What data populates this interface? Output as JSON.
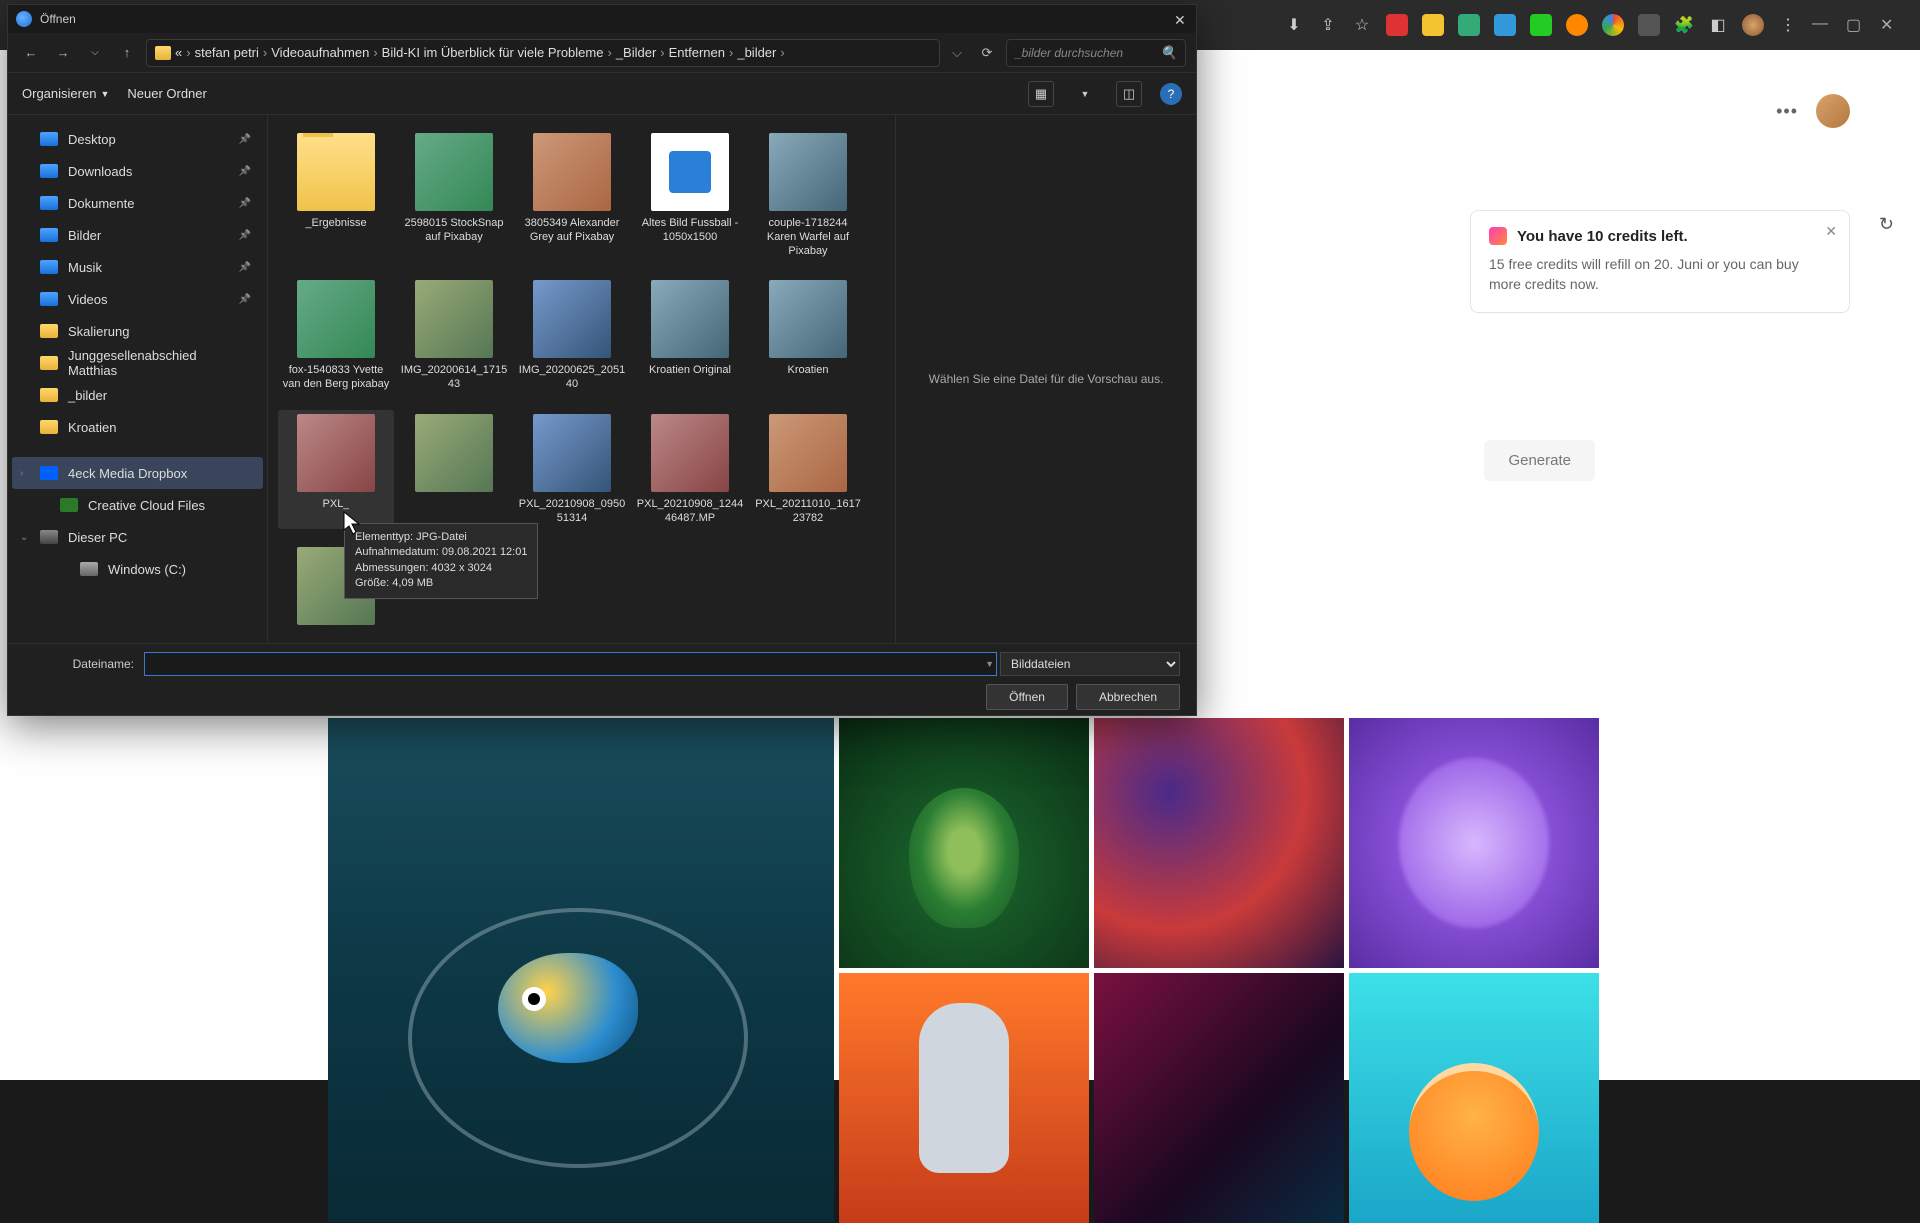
{
  "dialog": {
    "title": "Öffnen",
    "breadcrumb": [
      "«",
      "stefan petri",
      "Videoaufnahmen",
      "Bild-KI im Überblick für viele Probleme",
      "_Bilder",
      "Entfernen",
      "_bilder"
    ],
    "search_placeholder": "_bilder durchsuchen",
    "organize_label": "Organisieren",
    "new_folder_label": "Neuer Ordner",
    "preview_hint": "Wählen Sie eine Datei für die Vorschau aus.",
    "filename_label": "Dateiname:",
    "filetype_label": "Bilddateien",
    "open_btn": "Öffnen",
    "cancel_btn": "Abbrechen",
    "tooltip": {
      "l1": "Elementtyp: JPG-Datei",
      "l2": "Aufnahmedatum: 09.08.2021 12:01",
      "l3": "Abmessungen: 4032 x 3024",
      "l4": "Größe: 4,09 MB"
    },
    "sidebar": [
      {
        "icon": "desktop",
        "label": "Desktop",
        "pin": true
      },
      {
        "icon": "dl",
        "label": "Downloads",
        "pin": true
      },
      {
        "icon": "doc",
        "label": "Dokumente",
        "pin": true
      },
      {
        "icon": "pic",
        "label": "Bilder",
        "pin": true
      },
      {
        "icon": "mus",
        "label": "Musik",
        "pin": true
      },
      {
        "icon": "vid",
        "label": "Videos",
        "pin": true
      },
      {
        "icon": "folder",
        "label": "Skalierung"
      },
      {
        "icon": "folder",
        "label": "Junggesellenabschied Matthias"
      },
      {
        "icon": "folder",
        "label": "_bilder"
      },
      {
        "icon": "folder",
        "label": "Kroatien"
      }
    ],
    "sidebar2": [
      {
        "icon": "dropbox",
        "label": "4eck Media Dropbox",
        "exp": "›",
        "active": true
      },
      {
        "icon": "cc",
        "label": "Creative Cloud Files",
        "lvl": 2
      },
      {
        "icon": "pc",
        "label": "Dieser PC",
        "exp": "⌄",
        "lvl": 1
      },
      {
        "icon": "drive",
        "label": "Windows (C:)",
        "lvl": 3
      }
    ],
    "files": [
      {
        "name": "_Ergebnisse",
        "thumb": "folder-t"
      },
      {
        "name": "2598015 StockSnap auf Pixabay",
        "thumb": "ph"
      },
      {
        "name": "3805349 Alexander Grey auf Pixabay",
        "thumb": "ph2"
      },
      {
        "name": "Altes Bild Fussball - 1050x1500",
        "thumb": "doc-t"
      },
      {
        "name": "couple-1718244 Karen Warfel auf Pixabay",
        "thumb": "ph3"
      },
      {
        "name": "fox-1540833 Yvette van den Berg pixabay",
        "thumb": "ph"
      },
      {
        "name": "IMG_20200614_171543",
        "thumb": "ph6"
      },
      {
        "name": "IMG_20200625_205140",
        "thumb": "ph4"
      },
      {
        "name": "Kroatien Original",
        "thumb": "ph3"
      },
      {
        "name": "Kroatien",
        "thumb": "ph3"
      },
      {
        "name": "PXL_",
        "thumb": "ph5",
        "hover": true
      },
      {
        "name": "",
        "thumb": "ph6"
      },
      {
        "name": "PXL_20210908_095051314",
        "thumb": "ph4"
      },
      {
        "name": "PXL_20210908_124446487.MP",
        "thumb": "ph5"
      },
      {
        "name": "PXL_20211010_161723782",
        "thumb": "ph2"
      },
      {
        "name": "",
        "thumb": "ph6"
      }
    ]
  },
  "page": {
    "credits_title": "You have 10 credits left.",
    "credits_body": "15 free credits will refill on 20. Juni or you can buy more credits now.",
    "generate_label": "Generate"
  }
}
